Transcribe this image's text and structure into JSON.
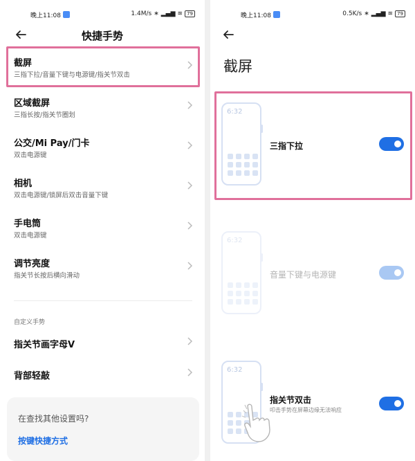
{
  "status": {
    "time": "晚上11:08",
    "left_speed": "1.4M/s",
    "right_speed": "0.5K/s",
    "battery": "79"
  },
  "left": {
    "title": "快捷手势",
    "items": [
      {
        "title": "截屏",
        "sub": "三指下拉/音量下键与电源键/指关节双击"
      },
      {
        "title": "区域截屏",
        "sub": "三指长按/指关节圈划"
      },
      {
        "title": "公交/Mi Pay/门卡",
        "sub": "双击电源键"
      },
      {
        "title": "相机",
        "sub": "双击电源键/锁屏后双击音量下键"
      },
      {
        "title": "手电筒",
        "sub": "双击电源键"
      },
      {
        "title": "调节亮度",
        "sub": "指关节长按后横向滑动"
      }
    ],
    "section_label": "自定义手势",
    "custom_items": [
      {
        "title": "指关节画字母V"
      },
      {
        "title": "背部轻敲"
      }
    ],
    "bottom": {
      "question": "在查找其他设置吗?",
      "link": "按键快捷方式"
    }
  },
  "right": {
    "title": "截屏",
    "options": [
      {
        "title": "三指下拉",
        "phone_time": "6:32",
        "enabled": true
      },
      {
        "title": "音量下键与电源键",
        "phone_time": "6:32",
        "enabled": true
      },
      {
        "title": "指关节双击",
        "sub": "叩击手势在屏幕边缘无法响应",
        "phone_time": "6:32",
        "enabled": true
      }
    ]
  },
  "colors": {
    "accent": "#1f6fe4",
    "highlight": "#e0709b"
  }
}
